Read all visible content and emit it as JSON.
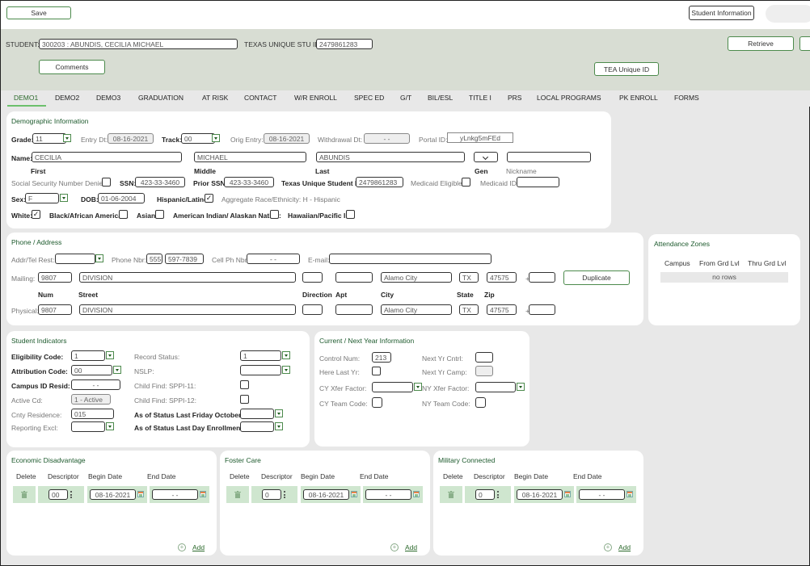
{
  "toolbar": {
    "save_label": "Save",
    "student_info_label": "Student Information"
  },
  "header": {
    "student_label": "STUDENT:",
    "student_value": "300203 : ABUNDIS, CECILIA MICHAEL",
    "tx_uid_label": "TEXAS UNIQUE STU ID:",
    "tx_uid_value": "2479861283",
    "comments_label": "Comments",
    "retrieve_label": "Retrieve",
    "tea_uid_label": "TEA Unique ID"
  },
  "tabs": [
    {
      "label": "DEMO1",
      "active": true
    },
    {
      "label": "DEMO2"
    },
    {
      "label": "DEMO3"
    },
    {
      "label": "GRADUATION"
    },
    {
      "label": "AT RISK"
    },
    {
      "label": "CONTACT"
    },
    {
      "label": "W/R ENROLL"
    },
    {
      "label": "SPEC ED"
    },
    {
      "label": "G/T"
    },
    {
      "label": "BIL/ESL"
    },
    {
      "label": "TITLE I"
    },
    {
      "label": "PRS"
    },
    {
      "label": "LOCAL PROGRAMS"
    },
    {
      "label": "PK ENROLL"
    },
    {
      "label": "FORMS"
    }
  ],
  "demographic": {
    "title": "Demographic Information",
    "grade_label": "Grade:",
    "grade_value": "11",
    "entry_dt_label": "Entry Dt:",
    "entry_dt_value": "08-16-2021",
    "track_label": "Track:",
    "track_value": "00",
    "orig_entry_label": "Orig Entry:",
    "orig_entry_value": "08-16-2021",
    "withdrawal_label": "Withdrawal Dt:",
    "withdrawal_value": "- -",
    "portal_label": "Portal ID:",
    "portal_value": "yLnkg5mFEd",
    "name_label": "Name:",
    "first_value": "CECILIA",
    "first_label": "First",
    "middle_value": "MICHAEL",
    "middle_label": "Middle",
    "last_value": "ABUNDIS",
    "last_label": "Last",
    "gen_label": "Gen",
    "nickname_label": "Nickname",
    "ssn_denied_label": "Social Security Number Denied",
    "ssn_label": "SSN:",
    "ssn_value": "423-33-3460",
    "prior_ssn_label": "Prior SSN:",
    "prior_ssn_value": "423-33-3460",
    "tsid_label": "Texas Unique Student ID:",
    "tsid_value": "2479861283",
    "medicaid_elig_label": "Medicaid Eligible:",
    "medicaid_id_label": "Medicaid ID:",
    "sex_label": "Sex:",
    "sex_value": "F",
    "dob_label": "DOB:",
    "dob_value": "01-06-2004",
    "hispanic_label": "Hispanic/Latino:",
    "hispanic_checked": "✓",
    "aggregate_label": "Aggregate Race/Ethnicity: H - Hispanic",
    "white_label": "White:",
    "white_checked": "✓",
    "black_label": "Black/African American:",
    "asian_label": "Asian:",
    "amind_label": "American Indian/ Alaskan Native:",
    "hawaiian_label": "Hawaiian/Pacific Isl:"
  },
  "phone": {
    "title": "Phone / Address",
    "addr_rest_label": "Addr/Tel Rest:",
    "phone_label": "Phone Nbr:",
    "area_code": "555",
    "phone_value": "597-7839",
    "cell_label": "Cell Ph Nbr:",
    "cell_value": "- -",
    "email_label": "E-mail:",
    "mailing_label": "Mailing:",
    "physical_label": "Physical:",
    "num_value": "9807",
    "street_value": "DIVISION",
    "city_value": "Alamo City",
    "state_value": "TX",
    "zip_value": "47575",
    "plus": "+",
    "num_label": "Num",
    "street_label": "Street",
    "direction_label": "Direction",
    "apt_label": "Apt",
    "city_label": "City",
    "state_label": "State",
    "zip_label": "Zip",
    "duplicate_label": "Duplicate"
  },
  "attendance": {
    "title": "Attendance Zones",
    "columns": [
      "Campus",
      "From Grd Lvl",
      "Thru Grd Lvl"
    ],
    "empty": "no rows"
  },
  "indicators": {
    "title": "Student Indicators",
    "eligibility_label": "Eligibility Code:",
    "eligibility_value": "1",
    "attribution_label": "Attribution Code:",
    "attribution_value": "00",
    "campus_resid_label": "Campus ID Resid:",
    "campus_resid_value": "- -",
    "active_label": "Active Cd:",
    "active_value": "1 - Active",
    "cnty_label": "Cnty Residence:",
    "cnty_value": "015",
    "reporting_label": "Reporting Excl:",
    "record_status_label": "Record Status:",
    "record_status_value": "1",
    "nslp_label": "NSLP:",
    "sppi11_label": "Child Find: SPPI-11:",
    "sppi12_label": "Child Find: SPPI-12:",
    "asof_oct_label": "As of Status Last Friday October:",
    "asof_last_label": "As of Status Last Day Enrollment:"
  },
  "current_next": {
    "title": "Current / Next Year Information",
    "control_label": "Control Num:",
    "control_value": "213",
    "here_last_label": "Here Last Yr:",
    "cy_xfer_label": "CY Xfer Factor:",
    "cy_team_label": "CY Team Code:",
    "ny_cntrl_label": "Next Yr Cntrl:",
    "ny_camp_label": "Next Yr Camp:",
    "ny_xfer_label": "NY Xfer Factor:",
    "ny_team_label": "NY Team Code:"
  },
  "grids": [
    {
      "title": "Economic Disadvantage",
      "descriptor": "00",
      "begin": "08-16-2021",
      "end": "- -"
    },
    {
      "title": "Foster Care",
      "descriptor": "0",
      "begin": "08-16-2021",
      "end": "- -"
    },
    {
      "title": "Military Connected",
      "descriptor": "0",
      "begin": "08-16-2021",
      "end": "- -"
    }
  ],
  "grid_columns": {
    "delete": "Delete",
    "descriptor": "Descriptor",
    "begin": "Begin Date",
    "end": "End Date"
  },
  "add_label": "Add"
}
